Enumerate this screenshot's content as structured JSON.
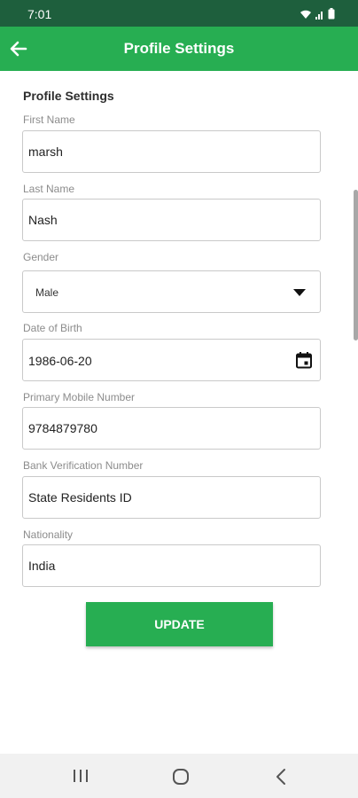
{
  "status_bar": {
    "time": "7:01",
    "icons": [
      "wifi-icon",
      "signal-icon",
      "battery-icon"
    ]
  },
  "app_bar": {
    "title": "Profile Settings",
    "back_icon": "arrow-left-icon"
  },
  "form": {
    "section_title": "Profile Settings",
    "first_name": {
      "label": "First Name",
      "value": "marsh"
    },
    "last_name": {
      "label": "Last Name",
      "value": "Nash"
    },
    "gender": {
      "label": "Gender",
      "value": "Male"
    },
    "dob": {
      "label": "Date of Birth",
      "value": "1986-06-20"
    },
    "mobile": {
      "label": "Primary Mobile Number",
      "value": "9784879780"
    },
    "bvn": {
      "label": "Bank Verification Number",
      "value": "State Residents ID"
    },
    "nationality": {
      "label": "Nationality",
      "value": "India"
    },
    "update_label": "UPDATE"
  },
  "nav_bar": {
    "buttons": [
      "recent-apps-icon",
      "home-icon",
      "back-icon"
    ]
  },
  "colors": {
    "primary": "#27ae52",
    "status_bar": "#1e5f3d"
  }
}
